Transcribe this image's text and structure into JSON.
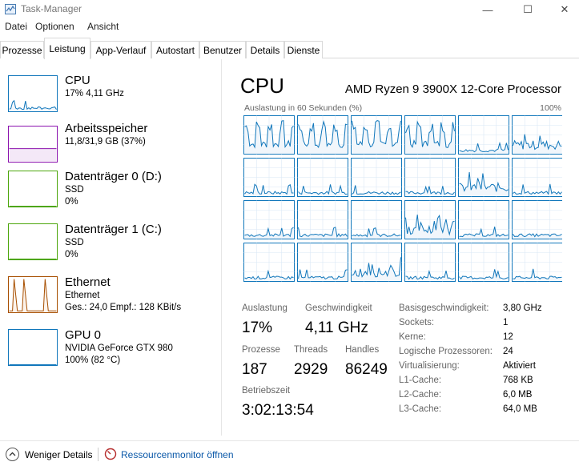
{
  "window": {
    "title": "Task-Manager",
    "minimize_glyph": "—",
    "maximize_glyph": "☐",
    "close_glyph": "✕"
  },
  "menu": [
    "Datei",
    "Optionen",
    "Ansicht"
  ],
  "tabs": [
    {
      "label": "Prozesse",
      "active": false
    },
    {
      "label": "Leistung",
      "active": true
    },
    {
      "label": "App-Verlauf",
      "active": false
    },
    {
      "label": "Autostart",
      "active": false
    },
    {
      "label": "Benutzer",
      "active": false
    },
    {
      "label": "Details",
      "active": false
    },
    {
      "label": "Dienste",
      "active": false
    }
  ],
  "sidebar": {
    "items": [
      {
        "title": "CPU",
        "lines": [
          "17% 4,11 GHz"
        ],
        "color": "#1177bb",
        "fill": "#f1f6fb",
        "selected": true
      },
      {
        "title": "Arbeitsspeicher",
        "lines": [
          "11,8/31,9 GB (37%)"
        ],
        "color": "#8b12ae",
        "fill": "#f4e8f7",
        "selected": false
      },
      {
        "title": "Datenträger 0 (D:)",
        "lines": [
          "SSD",
          "0%"
        ],
        "color": "#4da60c",
        "fill": "#ffffff",
        "selected": false
      },
      {
        "title": "Datenträger 1 (C:)",
        "lines": [
          "SSD",
          "0%"
        ],
        "color": "#4da60c",
        "fill": "#ffffff",
        "selected": false
      },
      {
        "title": "Ethernet",
        "lines": [
          "Ethernet",
          "Ges.: 24,0  Empf.: 128 KBit/s"
        ],
        "color": "#a74f01",
        "fill": "#fcf3eb",
        "selected": false
      },
      {
        "title": "GPU 0",
        "lines": [
          "NVIDIA GeForce GTX 980",
          "100% (82 °C)"
        ],
        "color": "#1177bb",
        "fill": "#f1f6fb",
        "selected": false
      }
    ]
  },
  "cpu": {
    "title": "CPU",
    "model": "AMD Ryzen 9 3900X 12-Core Processor",
    "graph_label": "Auslastung in 60 Sekunden (%)",
    "graph_max": "100%",
    "graph_color": "#1177bb",
    "graph_fill": "#f1f6fb",
    "grid_line_color": "#d9e8f5",
    "core_count": 24,
    "stats": [
      {
        "label": "Auslastung",
        "value": "17%"
      },
      {
        "label": "Geschwindigkeit",
        "value": "4,11 GHz"
      },
      {
        "label": "Prozesse",
        "value": "187"
      },
      {
        "label": "Threads",
        "value": "2929"
      },
      {
        "label": "Handles",
        "value": "86249"
      },
      {
        "label": "Betriebszeit",
        "value": "3:02:13:54"
      }
    ],
    "info": [
      {
        "key": "Basisgeschwindigkeit:",
        "value": "3,80 GHz"
      },
      {
        "key": "Sockets:",
        "value": "1"
      },
      {
        "key": "Kerne:",
        "value": "12"
      },
      {
        "key": "Logische Prozessoren:",
        "value": "24"
      },
      {
        "key": "Virtualisierung:",
        "value": "Aktiviert"
      },
      {
        "key": "L1-Cache:",
        "value": "768 KB"
      },
      {
        "key": "L2-Cache:",
        "value": "6,0 MB"
      },
      {
        "key": "L3-Cache:",
        "value": "64,0 MB"
      }
    ]
  },
  "footer": {
    "less_details": "Weniger Details",
    "resource_monitor": "Ressourcenmonitor öffnen"
  }
}
